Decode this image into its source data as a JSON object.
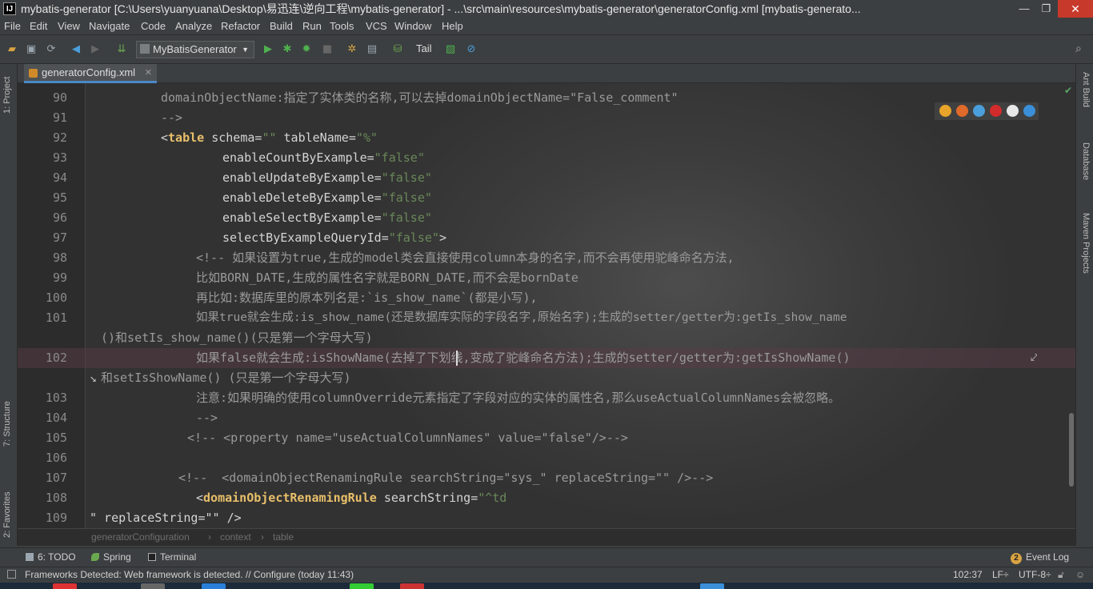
{
  "window": {
    "title": "mybatis-generator [C:\\Users\\yuanyuana\\Desktop\\易迅连\\逆向工程\\mybatis-generator] - ...\\src\\main\\resources\\mybatis-generator\\generatorConfig.xml [mybatis-generato...",
    "app_icon_text": "IJ",
    "minimize": "—",
    "maximize": "❐",
    "close": "✕"
  },
  "menu": [
    "File",
    "Edit",
    "View",
    "Navigate",
    "Code",
    "Analyze",
    "Refactor",
    "Build",
    "Run",
    "Tools",
    "VCS",
    "Window",
    "Help"
  ],
  "toolbar": {
    "run_config": "MyBatisGenerator",
    "tail_label": "Tail"
  },
  "tabs": [
    {
      "label": "generatorConfig.xml",
      "close": "✕"
    }
  ],
  "left_tools": [
    "1: Project",
    "7: Structure",
    "2: Favorites"
  ],
  "right_tools": [
    "Ant Build",
    "Database",
    "Maven Projects"
  ],
  "editor": {
    "lines": [
      {
        "n": "90",
        "text": "domainObjectName:指定了实体类的名称,可以去掉domainObjectName=\"False_comment\""
      },
      {
        "n": "91",
        "text": "-->"
      },
      {
        "n": "92",
        "tag": "table",
        "attr1": "schema",
        "val1": "\"\"",
        "attr2": "tableName",
        "val2": "\"%\""
      },
      {
        "n": "93",
        "attr": "enableCountByExample",
        "val": "\"false\""
      },
      {
        "n": "94",
        "attr": "enableUpdateByExample",
        "val": "\"false\""
      },
      {
        "n": "95",
        "attr": "enableDeleteByExample",
        "val": "\"false\""
      },
      {
        "n": "96",
        "attr": "enableSelectByExample",
        "val": "\"false\""
      },
      {
        "n": "97",
        "attr": "selectByExampleQueryId",
        "val": "\"false\""
      },
      {
        "n": "98",
        "text": "<!-- 如果设置为true,生成的model类会直接使用column本身的名字,而不会再使用驼峰命名方法,"
      },
      {
        "n": "99",
        "text": "比如BORN_DATE,生成的属性名字就是BORN_DATE,而不会是bornDate"
      },
      {
        "n": "100",
        "text": "再比如:数据库里的原本列名是:`is_show_name`(都是小写),"
      },
      {
        "n": "101",
        "text": "如果true就会生成:is_show_name(还是数据库实际的字段名字,原始名字);生成的setter/getter为:getIs_show_name",
        "wrap": "()和setIs_show_name()(只是第一个字母大写)"
      },
      {
        "n": "102",
        "text": "如果false就会生成:isShowName(去掉了下划线,变成了驼峰命名方法);生成的setter/getter为:getIsShowName()",
        "wrap": "和setIsShowName() (只是第一个字母大写)"
      },
      {
        "n": "103",
        "text": "注意:如果明确的使用columnOverride元素指定了字段对应的实体的属性名,那么useActualColumnNames会被忽略。"
      },
      {
        "n": "104",
        "text": "-->"
      },
      {
        "n": "105",
        "text": "<!-- <property name=\"useActualColumnNames\" value=\"false\"/>-->"
      },
      {
        "n": "106",
        "text": ""
      },
      {
        "n": "107",
        "text": "<!--  <domainObjectRenamingRule searchString=\"sys_\" replaceString=\"\" />-->"
      },
      {
        "n": "108",
        "tag": "domainObjectRenamingRule",
        "attr1": "searchString",
        "val1": "\"^td"
      },
      {
        "n": "109",
        "text": "\" replaceString=\"\" />"
      }
    ]
  },
  "breadcrumb": [
    "generatorConfiguration",
    "context",
    "table"
  ],
  "breadcrumb_sep": "›",
  "bottom_tools": [
    "6: TODO",
    "Spring",
    "Terminal"
  ],
  "event_log": {
    "count": "2",
    "label": "Event Log"
  },
  "status": {
    "message": "Frameworks Detected: Web framework is detected. // Configure (today 11:43)",
    "position": "102:37",
    "line_sep": "LF÷",
    "encoding": "UTF-8÷"
  }
}
